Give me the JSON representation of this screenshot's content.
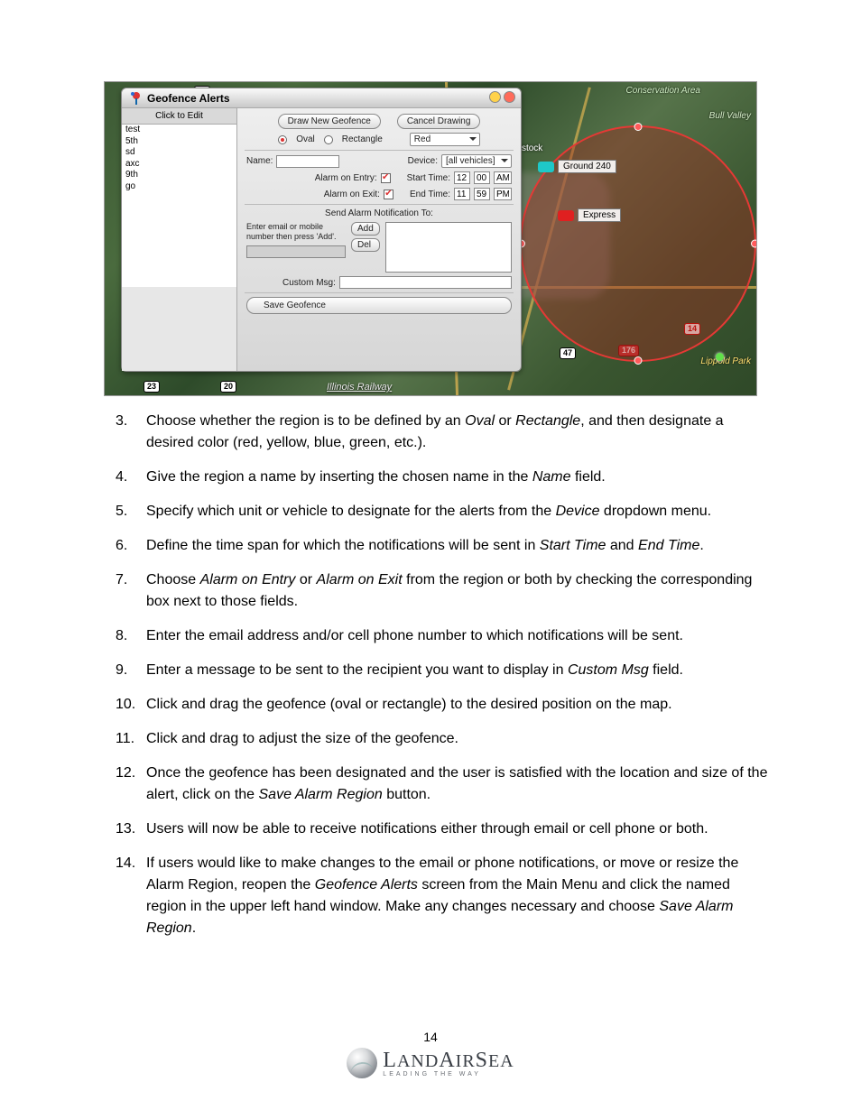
{
  "screenshot": {
    "panel_title": "Geofence Alerts",
    "sidebar_header": "Click to Edit",
    "sidebar_items": [
      "test",
      "5th",
      "sd",
      "axc",
      "9th",
      "go"
    ],
    "buttons": {
      "draw": "Draw New Geofence",
      "cancel": "Cancel Drawing",
      "add": "Add",
      "del": "Del",
      "save": "Save Geofence"
    },
    "shape": {
      "oval": "Oval",
      "rect": "Rectangle"
    },
    "color_value": "Red",
    "labels": {
      "name": "Name:",
      "device": "Device:",
      "alarm_entry": "Alarm on Entry:",
      "alarm_exit": "Alarm on Exit:",
      "start": "Start Time:",
      "end": "End Time:",
      "send_to": "Send Alarm Notification To:",
      "hint": "Enter email or mobile number then press 'Add'.",
      "custom": "Custom Msg:"
    },
    "device_value": "[all vehicles]",
    "start": {
      "h": "12",
      "m": "00",
      "ap": "AM"
    },
    "end": {
      "h": "11",
      "m": "59",
      "ap": "PM"
    },
    "map_labels": {
      "conservation": "Conservation\nArea",
      "bull": "Bull Valley",
      "lippold": "Lippold Park",
      "railway": "Illinois Railway",
      "woodstock": "Woodstock"
    },
    "vehicles": {
      "v1": "Ground 240",
      "v2": "Express"
    },
    "shields": {
      "s47": "47",
      "s23": "23",
      "s20": "20",
      "s176": "176",
      "s14": "14"
    }
  },
  "steps": {
    "s3a": "Choose whether the region is to be defined by an ",
    "s3_oval": "Oval",
    "s3b": " or ",
    "s3_rect": "Rectangle",
    "s3c": ", and then designate a desired color (red, yellow, blue, green, etc.).",
    "s4a": "Give the region a name by inserting the chosen name in the ",
    "s4_name": "Name",
    "s4b": " field.",
    "s5a": "Specify which unit or vehicle to designate for the alerts from the ",
    "s5_device": "Device",
    "s5b": " dropdown menu.",
    "s6a": "Define the time span for which the notifications will be sent in ",
    "s6_start": "Start Time",
    "s6b": " and ",
    "s6_end": "End Time",
    "s6c": ".",
    "s7a": "Choose ",
    "s7_entry": "Alarm on Entry",
    "s7b": " or ",
    "s7_exit": "Alarm on Exit",
    "s7c": " from the region or both by checking the corresponding box next to those fields.",
    "s8": "Enter the email address and/or cell phone number to which notifications will be sent.",
    "s9a": "Enter a message to be sent to the recipient you want to display in ",
    "s9_custom": "Custom Msg",
    "s9b": " field.",
    "s10": "Click and drag the geofence (oval or rectangle) to the desired position on the map.",
    "s11": "Click and drag to adjust the size of the geofence.",
    "s12a": "Once the geofence has been designated and the user is satisfied with the location and size of the alert, click on the ",
    "s12_save": "Save Alarm Region",
    "s12b": " button.",
    "s13": "Users will now be able to receive notifications either through email or cell phone or both.",
    "s14a": "If users would like to make changes to the email or phone notifications, or move or resize the Alarm Region, reopen the ",
    "s14_geo": "Geofence Alerts",
    "s14b": " screen from the Main Menu and click the named region in the upper left hand window. Make any changes necessary and choose ",
    "s14_save": "Save Alarm Region",
    "s14c": "."
  },
  "footer": {
    "page": "14",
    "brand_l": "L",
    "brand_and": "AND",
    "brand_a": "A",
    "brand_ir": "IR",
    "brand_s": "S",
    "brand_ea": "EA",
    "tagline": "LEADING THE WAY"
  }
}
